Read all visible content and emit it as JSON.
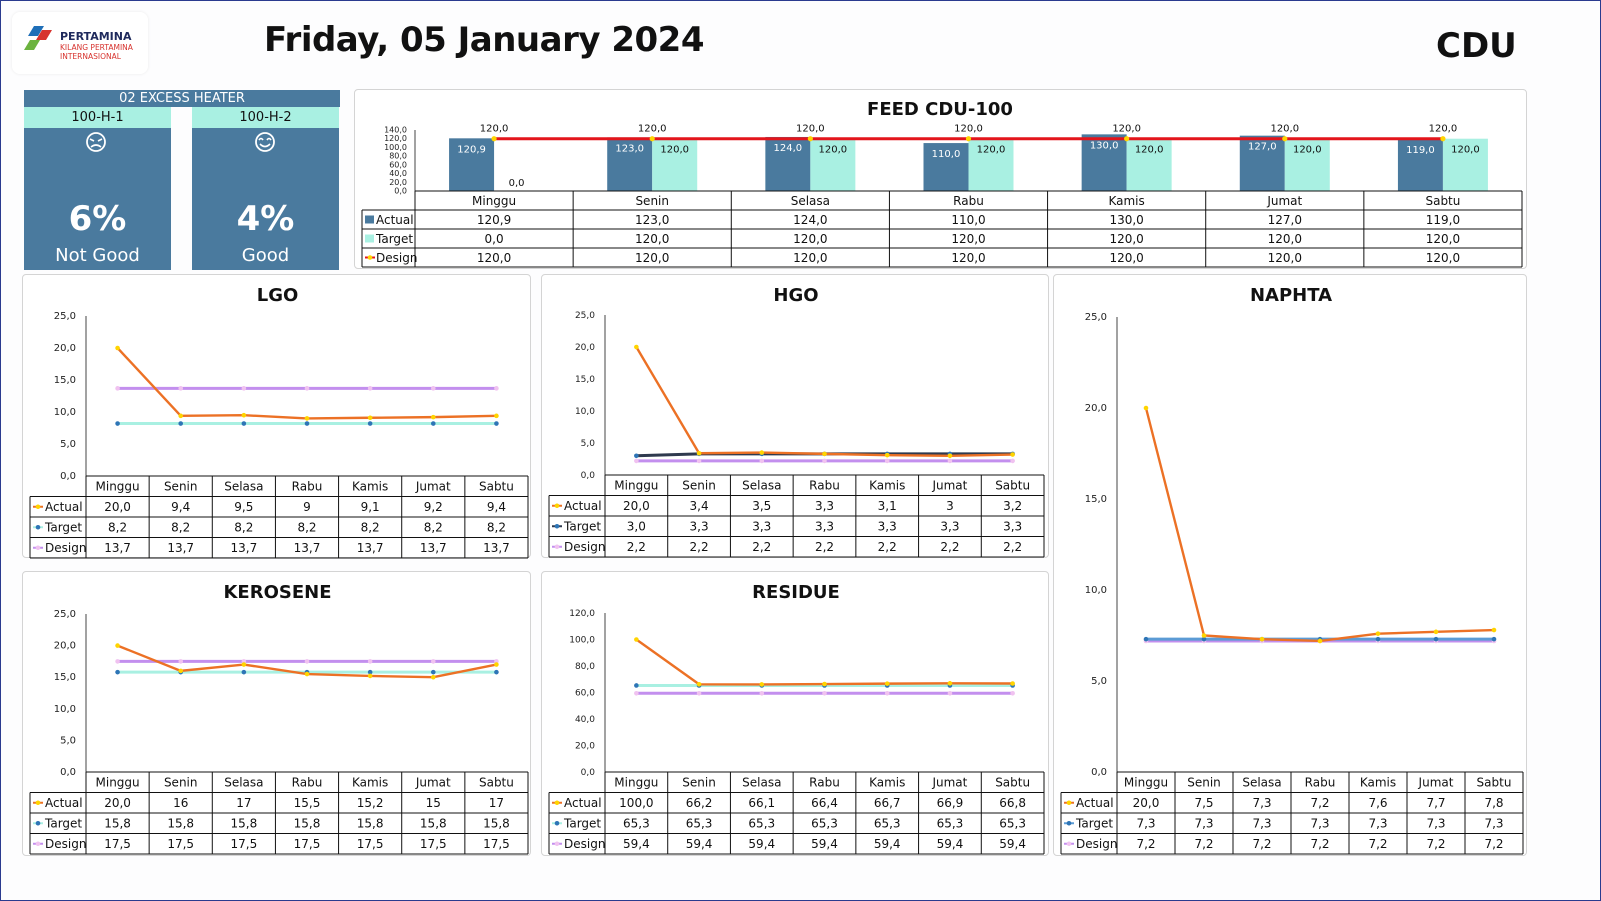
{
  "header": {
    "logo_name": "PERTAMINA",
    "logo_sub": "KILANG PERTAMINA INTERNASIONAL",
    "date": "Friday, 05 January 2024",
    "unit": "CDU"
  },
  "colors": {
    "heater_bg": "#4a7a9e",
    "heater_name_bg": "#a9f0e2",
    "actual_bar": "#4a7a9e",
    "target_bar": "#a9f0e2",
    "design_line": "#e3151b",
    "actual_line": "#ec7125",
    "target_line": "#a9f0e2",
    "design_line_purple": "#c38fee",
    "hgo_target_line": "#2f3a4e"
  },
  "heater": {
    "title": "02 EXCESS HEATER",
    "units": [
      {
        "name": "100-H-1",
        "icon": "sad-face-icon",
        "value": "6%",
        "status": "Not Good"
      },
      {
        "name": "100-H-2",
        "icon": "happy-face-icon",
        "value": "4%",
        "status": "Good"
      }
    ]
  },
  "chart_data": [
    {
      "id": "feed",
      "type": "bar",
      "title": "FEED CDU-100",
      "categories": [
        "Minggu",
        "Senin",
        "Selasa",
        "Rabu",
        "Kamis",
        "Jumat",
        "Sabtu"
      ],
      "ylim": [
        0,
        140
      ],
      "yticks": [
        "0,0",
        "20,0",
        "40,0",
        "60,0",
        "80,0",
        "100,0",
        "120,0",
        "140,0"
      ],
      "series": [
        {
          "name": "Actual",
          "values": [
            120.9,
            123.0,
            124.0,
            110.0,
            130.0,
            127.0,
            119.0
          ],
          "labels": [
            "120,9",
            "123,0",
            "124,0",
            "110,0",
            "130,0",
            "127,0",
            "119,0"
          ]
        },
        {
          "name": "Target",
          "values": [
            0.0,
            120.0,
            120.0,
            120.0,
            120.0,
            120.0,
            120.0
          ],
          "labels": [
            "0,0",
            "120,0",
            "120,0",
            "120,0",
            "120,0",
            "120,0",
            "120,0"
          ]
        },
        {
          "name": "Design",
          "values": [
            120.0,
            120.0,
            120.0,
            120.0,
            120.0,
            120.0,
            120.0
          ],
          "labels": [
            "120,0",
            "120,0",
            "120,0",
            "120,0",
            "120,0",
            "120,0",
            "120,0"
          ]
        }
      ]
    },
    {
      "id": "lgo",
      "type": "line",
      "title": "LGO",
      "categories": [
        "Minggu",
        "Senin",
        "Selasa",
        "Rabu",
        "Kamis",
        "Jumat",
        "Sabtu"
      ],
      "ylim": [
        0,
        25
      ],
      "yticks": [
        "0,0",
        "5,0",
        "10,0",
        "15,0",
        "20,0",
        "25,0"
      ],
      "series": [
        {
          "name": "Actual",
          "values": [
            20.0,
            9.4,
            9.5,
            9,
            9.1,
            9.2,
            9.4
          ],
          "labels": [
            "20,0",
            "9,4",
            "9,5",
            "9",
            "9,1",
            "9,2",
            "9,4"
          ]
        },
        {
          "name": "Target",
          "values": [
            8.2,
            8.2,
            8.2,
            8.2,
            8.2,
            8.2,
            8.2
          ],
          "labels": [
            "8,2",
            "8,2",
            "8,2",
            "8,2",
            "8,2",
            "8,2",
            "8,2"
          ]
        },
        {
          "name": "Design",
          "values": [
            13.7,
            13.7,
            13.7,
            13.7,
            13.7,
            13.7,
            13.7
          ],
          "labels": [
            "13,7",
            "13,7",
            "13,7",
            "13,7",
            "13,7",
            "13,7",
            "13,7"
          ]
        }
      ]
    },
    {
      "id": "hgo",
      "type": "line",
      "title": "HGO",
      "categories": [
        "Minggu",
        "Senin",
        "Selasa",
        "Rabu",
        "Kamis",
        "Jumat",
        "Sabtu"
      ],
      "ylim": [
        0,
        25
      ],
      "yticks": [
        "0,0",
        "5,0",
        "10,0",
        "15,0",
        "20,0",
        "25,0"
      ],
      "series": [
        {
          "name": "Actual",
          "values": [
            20.0,
            3.4,
            3.5,
            3.3,
            3.1,
            3,
            3.2
          ],
          "labels": [
            "20,0",
            "3,4",
            "3,5",
            "3,3",
            "3,1",
            "3",
            "3,2"
          ]
        },
        {
          "name": "Target",
          "values": [
            3.0,
            3.3,
            3.3,
            3.3,
            3.3,
            3.3,
            3.3
          ],
          "labels": [
            "3,0",
            "3,3",
            "3,3",
            "3,3",
            "3,3",
            "3,3",
            "3,3"
          ]
        },
        {
          "name": "Design",
          "values": [
            2.2,
            2.2,
            2.2,
            2.2,
            2.2,
            2.2,
            2.2
          ],
          "labels": [
            "2,2",
            "2,2",
            "2,2",
            "2,2",
            "2,2",
            "2,2",
            "2,2"
          ]
        }
      ]
    },
    {
      "id": "naphta",
      "type": "line",
      "title": "NAPHTA",
      "categories": [
        "Minggu",
        "Senin",
        "Selasa",
        "Rabu",
        "Kamis",
        "Jumat",
        "Sabtu"
      ],
      "ylim": [
        0,
        25
      ],
      "yticks": [
        "0,0",
        "5,0",
        "10,0",
        "15,0",
        "20,0",
        "25,0"
      ],
      "series": [
        {
          "name": "Actual",
          "values": [
            20.0,
            7.5,
            7.3,
            7.2,
            7.6,
            7.7,
            7.8
          ],
          "labels": [
            "20,0",
            "7,5",
            "7,3",
            "7,2",
            "7,6",
            "7,7",
            "7,8"
          ]
        },
        {
          "name": "Target",
          "values": [
            7.3,
            7.3,
            7.3,
            7.3,
            7.3,
            7.3,
            7.3
          ],
          "labels": [
            "7,3",
            "7,3",
            "7,3",
            "7,3",
            "7,3",
            "7,3",
            "7,3"
          ]
        },
        {
          "name": "Design",
          "values": [
            7.2,
            7.2,
            7.2,
            7.2,
            7.2,
            7.2,
            7.2
          ],
          "labels": [
            "7,2",
            "7,2",
            "7,2",
            "7,2",
            "7,2",
            "7,2",
            "7,2"
          ]
        }
      ]
    },
    {
      "id": "kerosene",
      "type": "line",
      "title": "KEROSENE",
      "categories": [
        "Minggu",
        "Senin",
        "Selasa",
        "Rabu",
        "Kamis",
        "Jumat",
        "Sabtu"
      ],
      "ylim": [
        0,
        25
      ],
      "yticks": [
        "0,0",
        "5,0",
        "10,0",
        "15,0",
        "20,0",
        "25,0"
      ],
      "series": [
        {
          "name": "Actual",
          "values": [
            20.0,
            16,
            17,
            15.5,
            15.2,
            15,
            17
          ],
          "labels": [
            "20,0",
            "16",
            "17",
            "15,5",
            "15,2",
            "15",
            "17"
          ]
        },
        {
          "name": "Target",
          "values": [
            15.8,
            15.8,
            15.8,
            15.8,
            15.8,
            15.8,
            15.8
          ],
          "labels": [
            "15,8",
            "15,8",
            "15,8",
            "15,8",
            "15,8",
            "15,8",
            "15,8"
          ]
        },
        {
          "name": "Design",
          "values": [
            17.5,
            17.5,
            17.5,
            17.5,
            17.5,
            17.5,
            17.5
          ],
          "labels": [
            "17,5",
            "17,5",
            "17,5",
            "17,5",
            "17,5",
            "17,5",
            "17,5"
          ]
        }
      ]
    },
    {
      "id": "residue",
      "type": "line",
      "title": "RESIDUE",
      "categories": [
        "Minggu",
        "Senin",
        "Selasa",
        "Rabu",
        "Kamis",
        "Jumat",
        "Sabtu"
      ],
      "ylim": [
        0,
        120
      ],
      "yticks": [
        "0,0",
        "20,0",
        "40,0",
        "60,0",
        "80,0",
        "100,0",
        "120,0"
      ],
      "series": [
        {
          "name": "Actual",
          "values": [
            100.0,
            66.2,
            66.1,
            66.4,
            66.7,
            66.9,
            66.8
          ],
          "labels": [
            "100,0",
            "66,2",
            "66,1",
            "66,4",
            "66,7",
            "66,9",
            "66,8"
          ]
        },
        {
          "name": "Target",
          "values": [
            65.3,
            65.3,
            65.3,
            65.3,
            65.3,
            65.3,
            65.3
          ],
          "labels": [
            "65,3",
            "65,3",
            "65,3",
            "65,3",
            "65,3",
            "65,3",
            "65,3"
          ]
        },
        {
          "name": "Design",
          "values": [
            59.4,
            59.4,
            59.4,
            59.4,
            59.4,
            59.4,
            59.4
          ],
          "labels": [
            "59,4",
            "59,4",
            "59,4",
            "59,4",
            "59,4",
            "59,4",
            "59,4"
          ]
        }
      ]
    }
  ]
}
